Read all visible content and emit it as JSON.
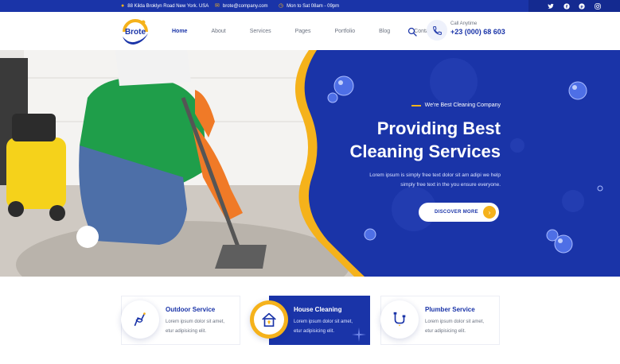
{
  "topbar": {
    "address": "88 Kilda Broklyn Road New York. USA",
    "email": "brote@company.com",
    "hours": "Mon to Sat 08am - 09pm",
    "social": [
      "twitter-icon",
      "facebook-icon",
      "pinterest-icon",
      "instagram-icon"
    ]
  },
  "header": {
    "logo_text": "Brote",
    "nav": [
      "Home",
      "About",
      "Services",
      "Pages",
      "Portfolio",
      "Blog",
      "Contact"
    ],
    "active_nav": "Home",
    "call_label": "Call Anytime",
    "call_number": "+23 (000) 68 603"
  },
  "hero": {
    "eyebrow": "We're Best Cleaning Company",
    "title_line1": "Providing Best",
    "title_line2": "Cleaning Services",
    "desc_line1": "Lorem ipsum is simply free text dolor sit am adipi we help",
    "desc_line2": "simply free text in the you ensure everyone.",
    "cta": "DISCOVER MORE"
  },
  "services": [
    {
      "title": "Outdoor Service",
      "desc_line1": "Lorem ipsum dolor sit amet,",
      "desc_line2": "etur adipisicing elit.",
      "icon": "outdoor-icon",
      "active": false
    },
    {
      "title": "House Cleaning",
      "desc_line1": "Lorem ipsum dolor sit amet,",
      "desc_line2": "etur adipisicing elit.",
      "icon": "house-cleaning-icon",
      "active": true
    },
    {
      "title": "Plumber Service",
      "desc_line1": "Lorem ipsum dolor sit amet,",
      "desc_line2": "etur adipisicing elit.",
      "icon": "plumber-icon",
      "active": false
    }
  ],
  "colors": {
    "primary": "#1a34a8",
    "accent": "#f5b21b",
    "text_muted": "#6b7280"
  }
}
